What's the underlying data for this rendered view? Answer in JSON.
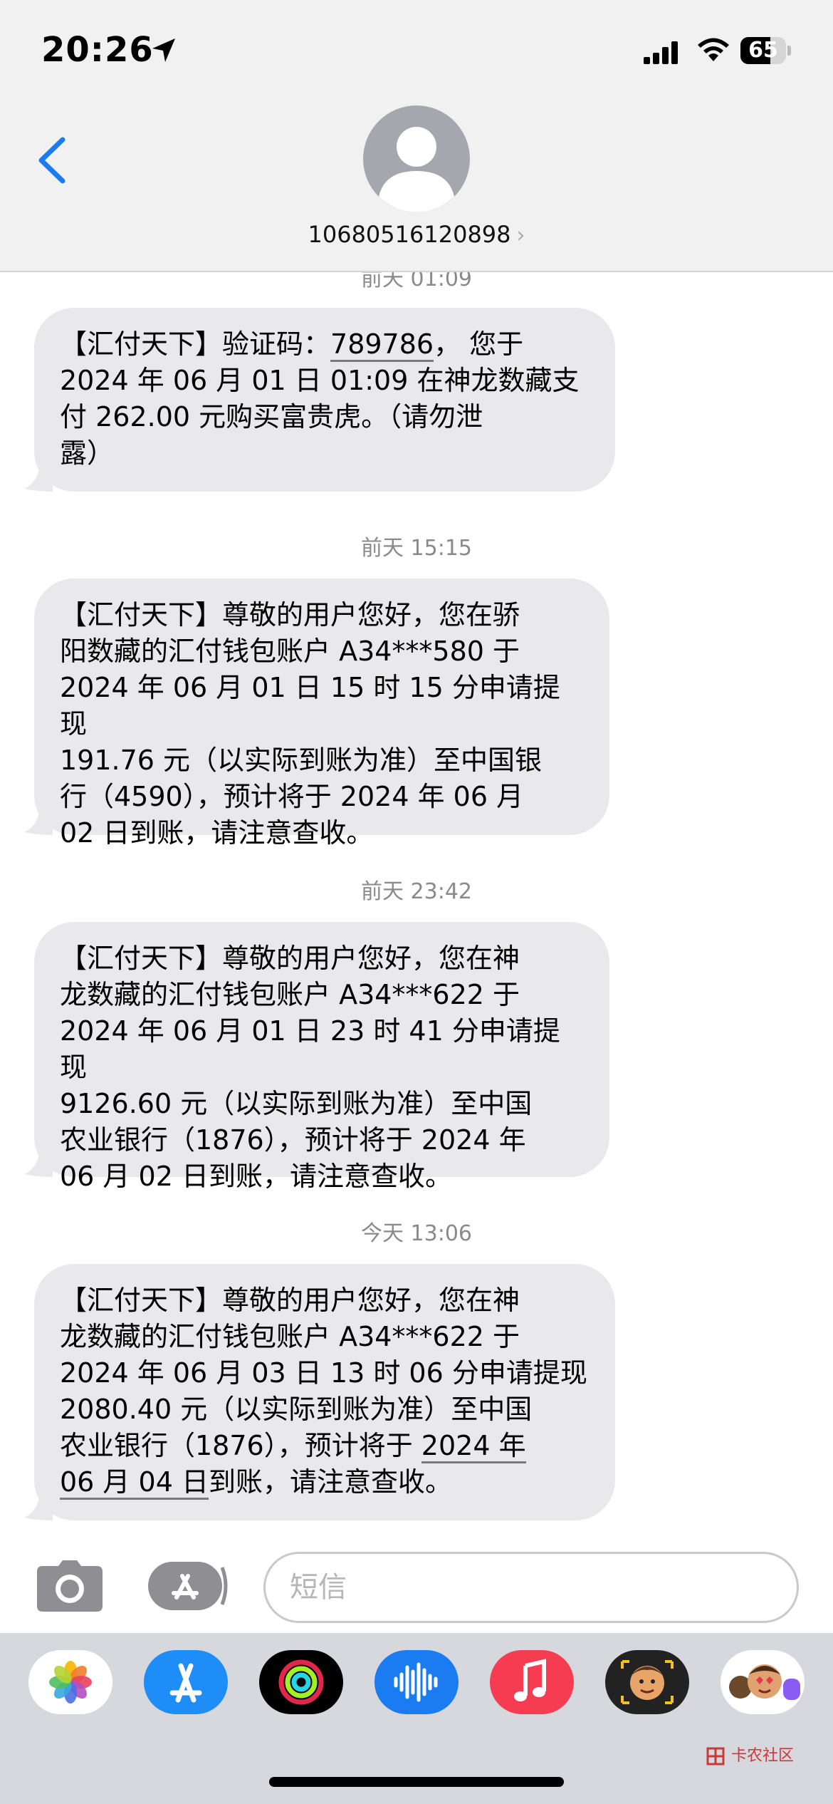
{
  "status": {
    "time": "20:26",
    "battery": "65",
    "battery_level": 0.65
  },
  "header": {
    "contact": "10680516120898",
    "chevron": "›"
  },
  "messages": [
    {
      "timestamp": "前天 01:09",
      "lines": [
        "【汇付天下】验证码：",
        "789786",
        "， 您于",
        "2024 年 06 月 01 日 01:09 在神龙数藏支",
        "付 262.00 元购买富贵虎。（请勿泄",
        "露）"
      ]
    },
    {
      "timestamp": "前天 15:15",
      "lines": [
        "【汇付天下】尊敬的用户您好，您在骄",
        "阳数藏的汇付钱包账户 A34***580 于",
        "2024 年 06 月 01 日 15 时 15 分申请提现",
        "191.76 元（以实际到账为准）至中国银",
        "行（4590），预计将于 2024 年 06 月",
        "02 日到账，请注意查收。"
      ]
    },
    {
      "timestamp": "前天 23:42",
      "lines": [
        "【汇付天下】尊敬的用户您好，您在神",
        "龙数藏的汇付钱包账户 A34***622 于",
        "2024 年 06 月 01 日 23 时 41 分申请提现",
        "9126.60 元（以实际到账为准）至中国",
        "农业银行（1876），预计将于 2024 年",
        "06 月 02 日到账，请注意查收。"
      ]
    },
    {
      "timestamp": "今天 13:06",
      "lines": [
        "【汇付天下】尊敬的用户您好，您在神",
        "龙数藏的汇付钱包账户 A34***622 于",
        "2024 年 06 月 03 日 13 时 06 分申请提现",
        "2080.40 元（以实际到账为准）至中国",
        "农业银行（1876），预计将于 ",
        "2024 年",
        "06 月 04 日",
        "到账，请注意查收。"
      ]
    }
  ],
  "composer": {
    "placeholder": "短信"
  },
  "app_drawer": [
    {
      "icon": "photos-icon",
      "color": "#ffffff"
    },
    {
      "icon": "app-store-icon",
      "color": "#1e8df7"
    },
    {
      "icon": "fitness-icon",
      "color": "#000000"
    },
    {
      "icon": "audio-icon",
      "color": "#1a7cf0"
    },
    {
      "icon": "music-icon",
      "color": "#f53c51"
    },
    {
      "icon": "memoji-icon",
      "color": "#222222"
    },
    {
      "icon": "memoji-stickers-icon",
      "color": "#ffffff"
    }
  ],
  "watermark": "卡农社区"
}
